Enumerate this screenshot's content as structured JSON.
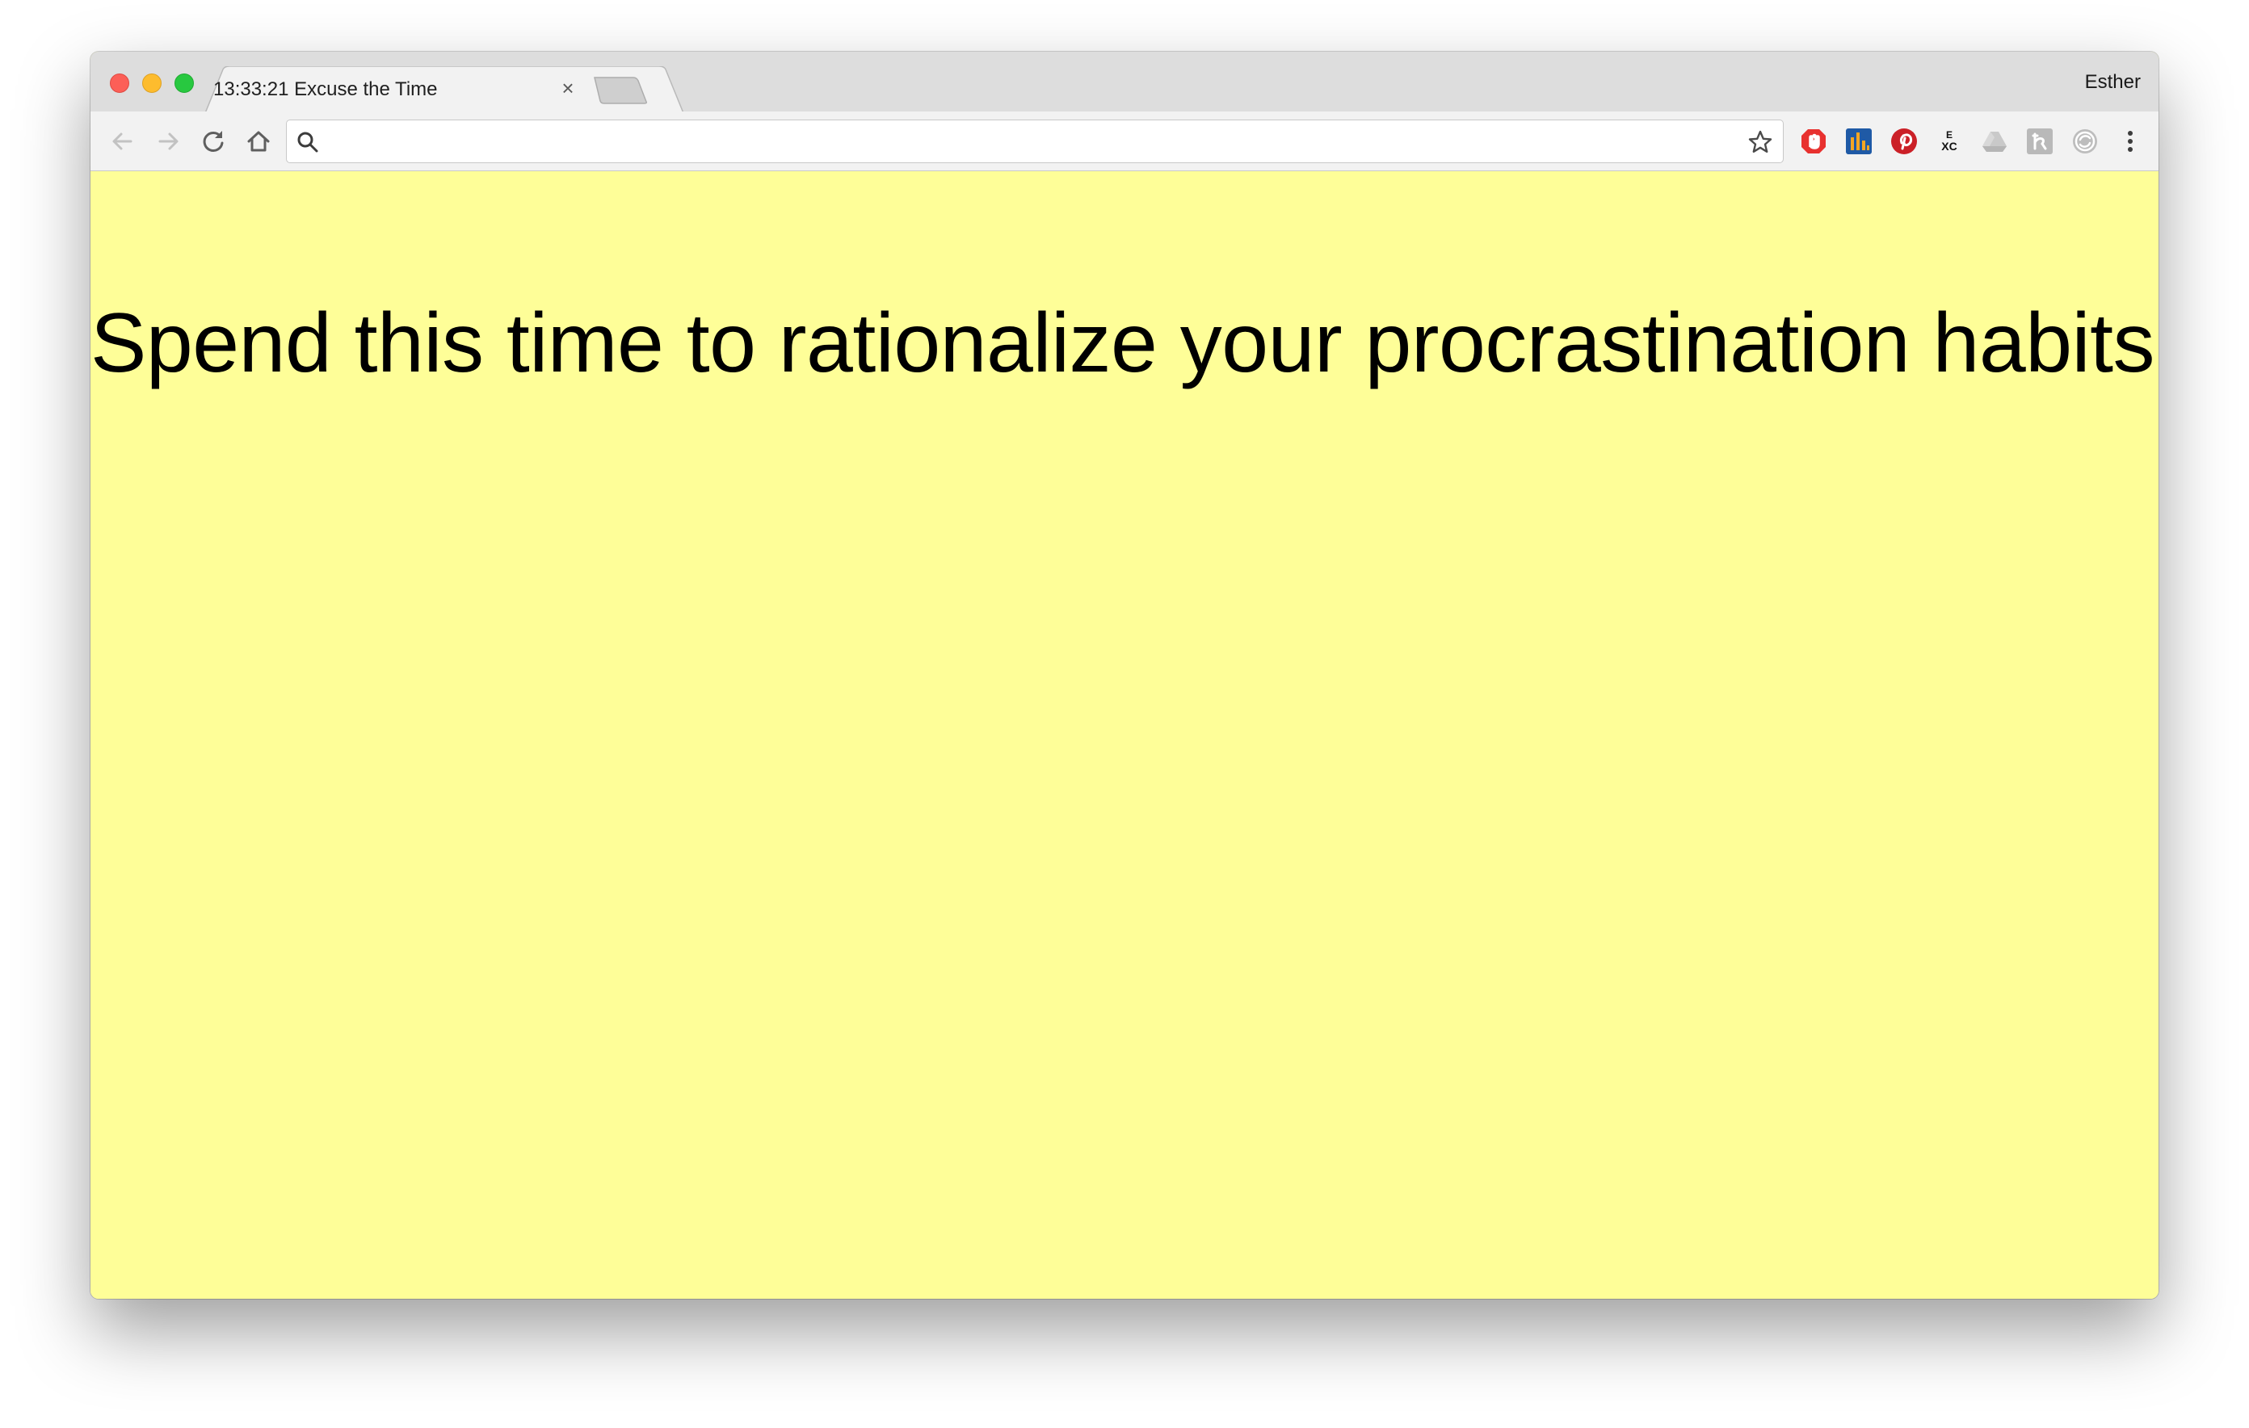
{
  "window": {
    "tab_title": "13:33:21 Excuse the Time",
    "close_tab_glyph": "×",
    "profile_name": "Esther"
  },
  "toolbar": {
    "search_placeholder": "",
    "address_value": "",
    "icons": [
      "back-icon",
      "forward-icon",
      "reload-icon",
      "home-icon",
      "search-icon",
      "star-icon",
      "menu-icon"
    ]
  },
  "extensions": [
    "adblock-extension-icon",
    "analytics-extension-icon",
    "pinterest-extension-icon",
    "exc-extension-icon",
    "drive-extension-icon",
    "hk-extension-icon",
    "sync-extension-icon"
  ],
  "extension_labels": {
    "exc_top": "E",
    "exc_bottom": "XC"
  },
  "page": {
    "headline": "Spend this time to rationalize your procrastination habits.",
    "background_color": "#fefe98"
  }
}
